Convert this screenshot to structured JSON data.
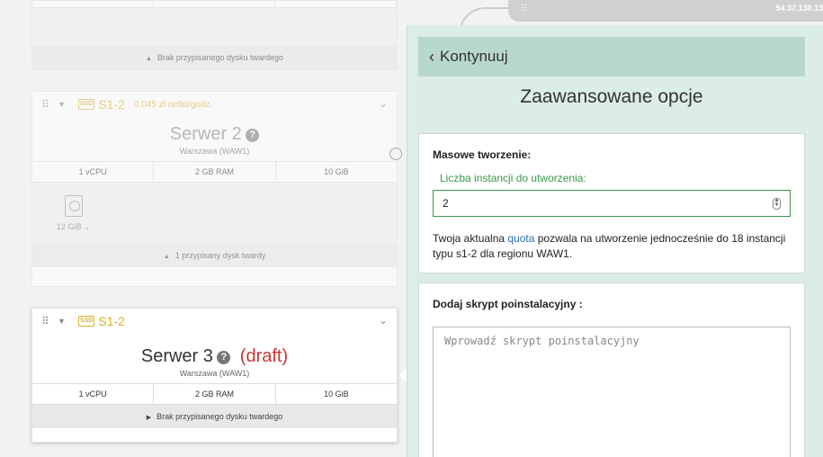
{
  "top_card": {
    "disk_bar": "Brak przypisanego dysku twardego"
  },
  "server2": {
    "flavor": "S1-2",
    "price": "0.045 zł netto/godz.",
    "name": "Serwer 2",
    "region": "Warszawa (WAW1)",
    "vcpu": "1 vCPU",
    "ram": "2 GB RAM",
    "disk": "10 GiB",
    "disk_size": "12 GiB",
    "disk_bar": "1 przypisany dysk twardy"
  },
  "server3": {
    "flavor": "S1-2",
    "name": "Serwer 3",
    "draft": "(draft)",
    "region": "Warszawa (WAW1)",
    "vcpu": "1 vCPU",
    "ram": "2 GB RAM",
    "disk": "10 GiB",
    "disk_bar": "Brak przypisanego dysku twardego"
  },
  "topstrip": {
    "ip": "54.37.130.13"
  },
  "panel": {
    "back_label": "Kontynuuj",
    "title": "Zaawansowane opcje",
    "mass": {
      "title": "Masowe tworzenie:",
      "field_label": "Liczba instancji do utworzenia:",
      "value": "2",
      "info_pre": "Twoja aktualna ",
      "info_link": "quota",
      "info_post": " pozwala na utworzenie jednocześnie do 18 instancji typu s1-2 dla regionu WAW1."
    },
    "script": {
      "title": "Dodaj skrypt poinstalacyjny :",
      "placeholder": "Wprowadź skrypt poinstalacyjny"
    }
  }
}
